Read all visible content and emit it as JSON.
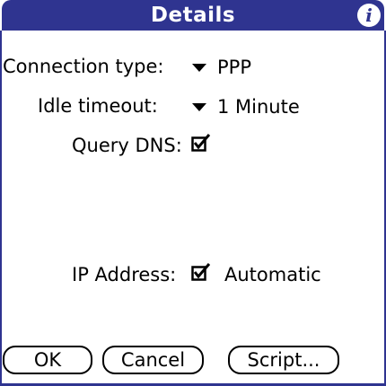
{
  "header": {
    "title": "Details",
    "info_icon": "info-icon",
    "info_glyph": "i",
    "accent_color": "#2f3490"
  },
  "form": {
    "connection_type": {
      "label": "Connection type:",
      "value": "PPP"
    },
    "idle_timeout": {
      "label": "Idle timeout:",
      "value": "1 Minute"
    },
    "query_dns": {
      "label": "Query DNS:",
      "checked": true
    },
    "ip_address": {
      "label": "IP Address:",
      "checked": true,
      "option_text": "Automatic"
    }
  },
  "buttons": {
    "ok": "OK",
    "cancel": "Cancel",
    "script": "Script..."
  }
}
